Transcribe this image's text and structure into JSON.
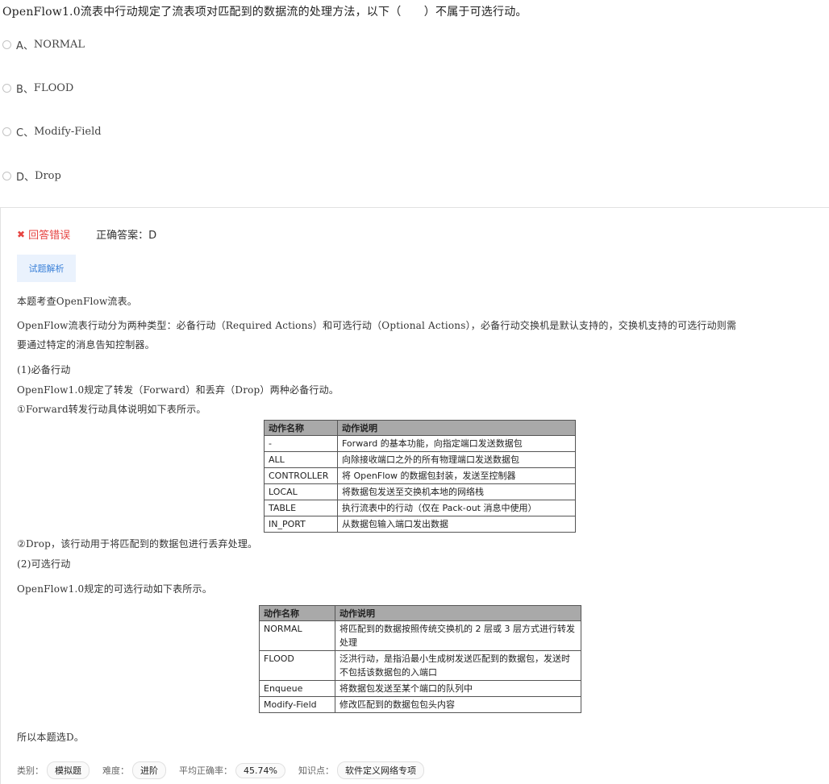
{
  "question": "OpenFlow1.0流表中行动规定了流表项对匹配到的数据流的处理方法，以下（　　）不属于可选行动。",
  "options": [
    {
      "key": "A、",
      "text": "NORMAL"
    },
    {
      "key": "B、",
      "text": "FLOOD"
    },
    {
      "key": "C、",
      "text": "Modify-Field"
    },
    {
      "key": "D、",
      "text": "Drop"
    }
  ],
  "result": {
    "status": "回答错误",
    "correct_label": "正确答案：",
    "correct_value": "D"
  },
  "analysis_tab": "试题解析",
  "paragraphs": {
    "p1": "本题考查OpenFlow流表。",
    "p2_line1": "OpenFlow流表行动分为两种类型：必备行动（Required Actions）和可选行动（Optional Actions），必备行动交换机是默认支持的，交换机支持的可选行动则需",
    "p2_line2": "要通过特定的消息告知控制器。",
    "p3": "(1)必备行动",
    "p4": "OpenFlow1.0规定了转发（Forward）和丢弃（Drop）两种必备行动。",
    "p5": "①Forward转发行动具体说明如下表所示。",
    "p6": "②Drop，该行动用于将匹配到的数据包进行丢弃处理。",
    "p7": "(2)可选行动",
    "p8": "OpenFlow1.0规定的可选行动如下表所示。",
    "p9": "所以本题选D。"
  },
  "table1": {
    "headers": [
      "动作名称",
      "动作说明"
    ],
    "rows": [
      [
        "-",
        "Forward 的基本功能，向指定端口发送数据包"
      ],
      [
        "ALL",
        "向除接收端口之外的所有物理端口发送数据包"
      ],
      [
        "CONTROLLER",
        "将 OpenFlow 的数据包封装，发送至控制器"
      ],
      [
        "LOCAL",
        "将数据包发送至交换机本地的网络栈"
      ],
      [
        "TABLE",
        "执行流表中的行动（仅在 Pack-out 消息中使用）"
      ],
      [
        "IN_PORT",
        "从数据包输入端口发出数据"
      ]
    ]
  },
  "table2": {
    "headers": [
      "动作名称",
      "动作说明"
    ],
    "rows": [
      [
        "NORMAL",
        "将匹配到的数据按照传统交换机的 2 层或 3 层方式进行转发处理"
      ],
      [
        "FLOOD",
        "泛洪行动，是指沿最小生成树发送匹配到的数据包，发送时不包括该数据包的入端口"
      ],
      [
        "Enqueue",
        "将数据包发送至某个端口的队列中"
      ],
      [
        "Modify-Field",
        "修改匹配到的数据包包头内容"
      ]
    ]
  },
  "meta": {
    "category_label": "类别：",
    "category": "模拟题",
    "difficulty_label": "难度：",
    "difficulty": "进阶",
    "accuracy_label": "平均正确率：",
    "accuracy": "45.74%",
    "knowledge_label": "知识点：",
    "knowledge": "软件定义网络专项"
  }
}
